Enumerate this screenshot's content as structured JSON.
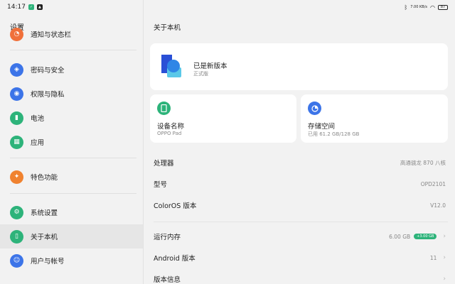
{
  "status_bar": {
    "time": "14:17",
    "net_speed": "7.00 KB/s",
    "battery": "87"
  },
  "settings": {
    "title": "设置",
    "items": [
      {
        "label": "通知与状态栏",
        "icon": "bell-icon",
        "color": "#f0703a"
      },
      {
        "label": "密码与安全",
        "icon": "shield-icon",
        "color": "#3c74e8"
      },
      {
        "label": "权限与隐私",
        "icon": "eye-icon",
        "color": "#3c74e8"
      },
      {
        "label": "电池",
        "icon": "battery-icon",
        "color": "#2db37a"
      },
      {
        "label": "应用",
        "icon": "apps-icon",
        "color": "#2db37a"
      },
      {
        "label": "特色功能",
        "icon": "star-icon",
        "color": "#f0822f"
      },
      {
        "label": "系统设置",
        "icon": "gear-icon",
        "color": "#2db37a"
      },
      {
        "label": "关于本机",
        "icon": "phone-icon",
        "color": "#2db37a"
      },
      {
        "label": "用户与帐号",
        "icon": "user-icon",
        "color": "#3c74e8"
      }
    ]
  },
  "about": {
    "title": "关于本机",
    "version_card": {
      "title": "已是新版本",
      "subtitle": "正式版"
    },
    "device_card": {
      "title": "设备名称",
      "value": "OPPO Pad",
      "icon": "tablet-icon",
      "color": "#2db37a"
    },
    "storage_card": {
      "title": "存储空间",
      "value": "已用 61.2 GB/128 GB",
      "icon": "pie-chart-icon",
      "color": "#3c74e8"
    },
    "rows": [
      {
        "label": "处理器",
        "value": "高通骁龙 870 八核"
      },
      {
        "label": "型号",
        "value": "OPD2101"
      },
      {
        "label": "ColorOS 版本",
        "value": "V12.0"
      },
      {
        "label": "运行内存",
        "value": "6.00 GB",
        "badge": "+3.00 GB"
      },
      {
        "label": "Android 版本",
        "value": "11"
      },
      {
        "label": "版本信息",
        "value": ""
      }
    ]
  }
}
